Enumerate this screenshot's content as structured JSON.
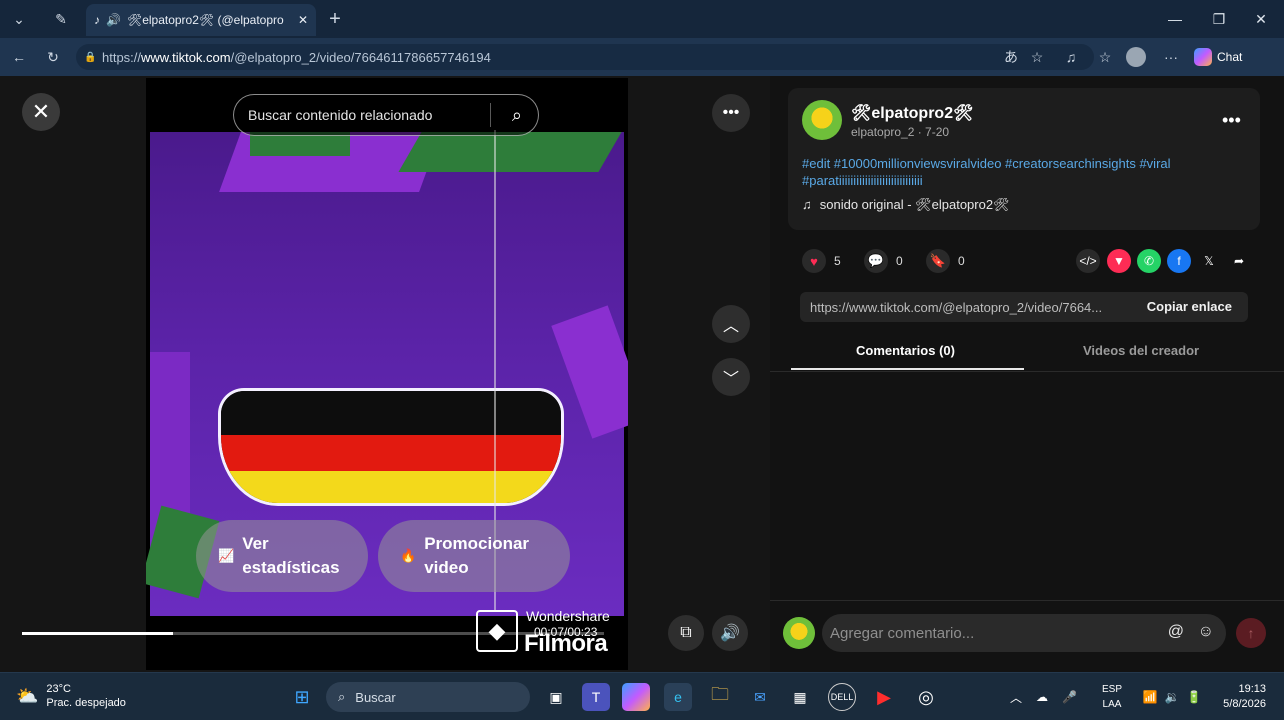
{
  "browser": {
    "tab_title": "🛠elpatopro2🛠 (@elpatopro",
    "url_prefix": "https://",
    "url_host": "www.tiktok.com",
    "url_path": "/@elpatopro_2/video/7664611786657746194",
    "chat_label": "Chat"
  },
  "player": {
    "search_placeholder": "Buscar contenido relacionado",
    "stats_label_1": "Ver",
    "stats_label_2": "estadísticas",
    "promote_label_1": "Promocionar",
    "promote_label_2": "video",
    "progress_fraction": 0.26,
    "watermark_brand": "Wondershare",
    "watermark_product": "Filmora",
    "time": "00:07/00:23"
  },
  "post": {
    "display_name": "🛠elpatopro2🛠",
    "username_date": "elpatopro_2 · 7-20",
    "description": "#edit #10000millionviewsviralvideo #creatorsearchinsights #viral #paratiiiiiiiiiiiiiiiiiiiiiiiiiiiii",
    "sound": "sonido original - 🛠elpatopro2🛠",
    "likes": "5",
    "comments": "0",
    "saves": "0",
    "share_link": "https://www.tiktok.com/@elpatopro_2/video/7664...",
    "copy_link_label": "Copiar enlace",
    "tab_comments": "Comentarios (0)",
    "tab_creator_videos": "Videos del creador",
    "comment_placeholder": "Agregar comentario..."
  },
  "taskbar": {
    "temperature": "23°C",
    "weather": "Prac. despejado",
    "search_label": "Buscar",
    "lang_1": "ESP",
    "lang_2": "LAA",
    "time": "19:13",
    "date": "5/8/2026"
  },
  "colors": {
    "accent_blue": "#5aa9e6",
    "like_red": "#fe2c55",
    "video_purple": "#5b23a8"
  }
}
